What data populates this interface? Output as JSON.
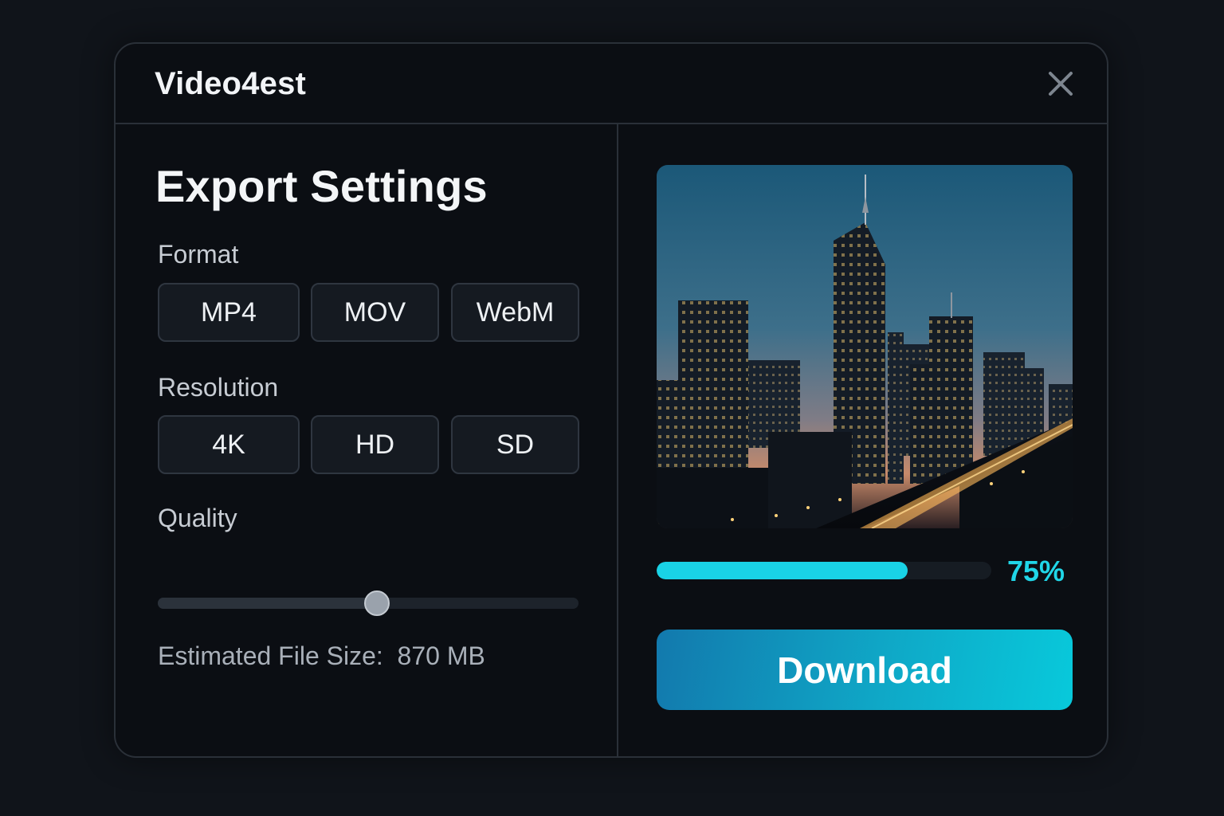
{
  "window": {
    "title": "Video4est",
    "close_icon": "close-icon"
  },
  "settings": {
    "heading": "Export Settings",
    "format": {
      "label": "Format",
      "options": [
        "MP4",
        "MOV",
        "WebM"
      ]
    },
    "resolution": {
      "label": "Resolution",
      "options": [
        "4K",
        "HD",
        "SD"
      ]
    },
    "quality": {
      "label": "Quality",
      "value_fraction": 0.52
    },
    "file_size": {
      "label": "Estimated File Size:",
      "value": "870 MB"
    }
  },
  "preview": {
    "image_subject": "city-skyline-at-dusk"
  },
  "progress": {
    "percent": 75,
    "text": "75%"
  },
  "download": {
    "label": "Download"
  },
  "colors": {
    "accent": "#19d3e6",
    "button_gradient_start": "#1279ad",
    "button_gradient_end": "#08c9db",
    "background": "#0b0e13"
  }
}
